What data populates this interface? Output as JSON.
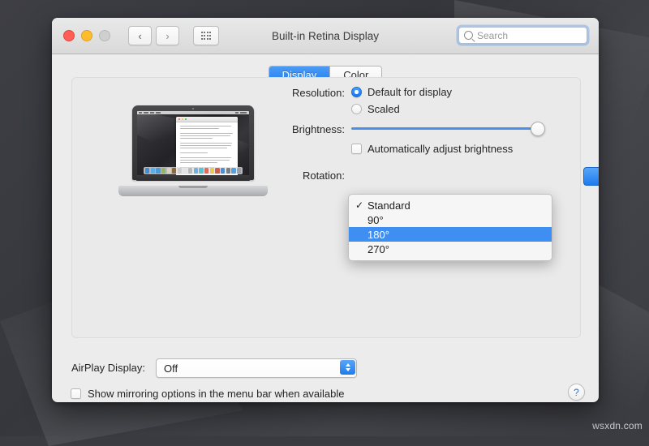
{
  "desktop": {
    "watermark": "wsxdn.com"
  },
  "window": {
    "title": "Built-in Retina Display",
    "traffic": {
      "close": "close-button",
      "minimize": "minimize-button",
      "zoom": "zoom-button"
    },
    "nav": {
      "back": "‹",
      "forward": "›"
    },
    "show_all": "show-all-grid-button",
    "search": {
      "placeholder": "Search",
      "value": ""
    }
  },
  "tabs": [
    {
      "label": "Display",
      "active": true
    },
    {
      "label": "Color",
      "active": false
    }
  ],
  "display_pane": {
    "resolution": {
      "label": "Resolution:",
      "options": [
        {
          "label": "Default for display",
          "selected": true
        },
        {
          "label": "Scaled",
          "selected": false
        }
      ]
    },
    "brightness": {
      "label": "Brightness:",
      "value": 100,
      "auto_adjust": {
        "label": "Automatically adjust brightness",
        "checked": false
      }
    },
    "rotation": {
      "label": "Rotation:",
      "selected": "Standard",
      "menu_open": true,
      "options": [
        {
          "label": "Standard",
          "checked": true,
          "highlighted": false
        },
        {
          "label": "90°",
          "checked": false,
          "highlighted": false
        },
        {
          "label": "180°",
          "checked": false,
          "highlighted": true
        },
        {
          "label": "270°",
          "checked": false,
          "highlighted": false
        }
      ]
    }
  },
  "bottom": {
    "airplay_label": "AirPlay Display:",
    "airplay_value": "Off",
    "mirroring": {
      "label": "Show mirroring options in the menu bar when available",
      "checked": false
    },
    "help": "?"
  },
  "colors": {
    "accent": "#1d7bef",
    "highlight": "#3f8ef1",
    "window_bg": "#ececec",
    "panel_bg": "#eaeaea"
  }
}
